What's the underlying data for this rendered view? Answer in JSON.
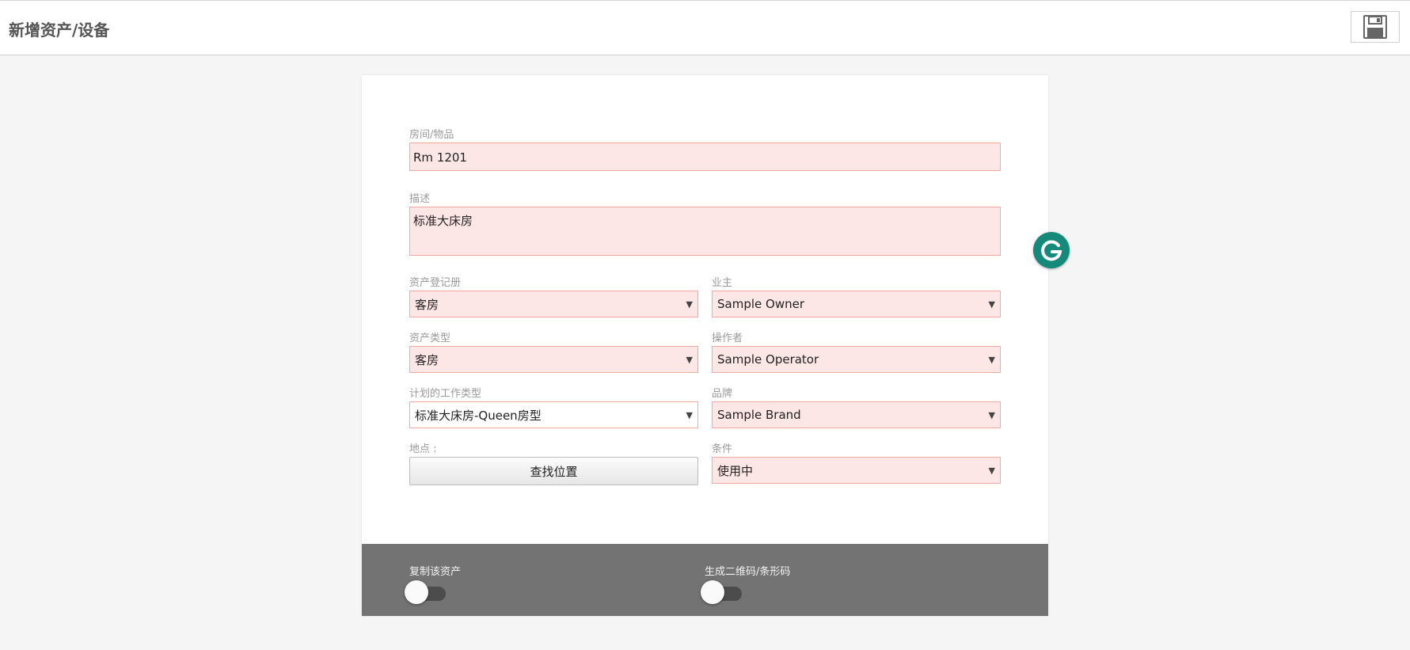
{
  "header": {
    "title": "新增资产/设备",
    "save_icon": "save-icon"
  },
  "form": {
    "room": {
      "label": "房间/物品",
      "value": "Rm 1201"
    },
    "description": {
      "label": "描述",
      "value": "标准大床房"
    },
    "asset_register": {
      "label": "资产登记册",
      "value": "客房"
    },
    "owner": {
      "label": "业主",
      "value": "Sample Owner"
    },
    "asset_type": {
      "label": "资产类型",
      "value": "客房"
    },
    "operator": {
      "label": "操作者",
      "value": "Sample Operator"
    },
    "planned_work_type": {
      "label": "计划的工作类型",
      "value": "标准大床房-Queen房型"
    },
    "brand": {
      "label": "品牌",
      "value": "Sample Brand"
    },
    "location": {
      "label": "地点 :",
      "button": "查找位置"
    },
    "condition": {
      "label": "条件",
      "value": "使用中"
    },
    "caret": "▼"
  },
  "footer": {
    "copy_asset": {
      "label": "复制该资产",
      "on": false
    },
    "generate_code": {
      "label": "生成二维码/条形码",
      "on": false
    }
  },
  "grammarly": {
    "icon": "grammarly-icon",
    "color": "#15897a"
  },
  "colors": {
    "field_bg": "#fde6e6",
    "field_border": "#f0a8a0",
    "footer_bg": "#737373"
  }
}
